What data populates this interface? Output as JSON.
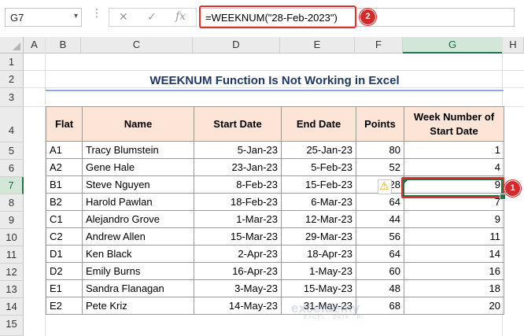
{
  "formula_bar": {
    "name_box": "G7",
    "cancel_icon": "✕",
    "confirm_icon": "✓",
    "fx_label": "fx",
    "formula": "=WEEKNUM(\"28-Feb-2023\")"
  },
  "badges": {
    "formula": "2",
    "cell": "1"
  },
  "columns": [
    "A",
    "B",
    "C",
    "D",
    "E",
    "F",
    "G",
    "H"
  ],
  "rows": [
    "1",
    "2",
    "3",
    "4",
    "5",
    "6",
    "7",
    "8",
    "9",
    "10",
    "11",
    "12",
    "13",
    "14",
    "15"
  ],
  "title": "WEEKNUM Function Is Not Working in Excel",
  "table": {
    "headers": [
      "Flat",
      "Name",
      "Start Date",
      "End Date",
      "Points",
      "Week Number of Start Date"
    ],
    "rows": [
      [
        "A1",
        "Tracy Blumstein",
        "5-Jan-23",
        "25-Jan-23",
        "80",
        "1"
      ],
      [
        "A2",
        "Gene Hale",
        "23-Jan-23",
        "5-Feb-23",
        "52",
        "4"
      ],
      [
        "B1",
        "Steve Nguyen",
        "8-Feb-23",
        "15-Feb-23",
        "28",
        "9"
      ],
      [
        "B2",
        "Harold Pawlan",
        "18-Feb-23",
        "6-Mar-23",
        "64",
        "7"
      ],
      [
        "C1",
        "Alejandro Grove",
        "1-Mar-23",
        "12-Mar-23",
        "44",
        "9"
      ],
      [
        "C2",
        "Andrew Allen",
        "15-Mar-23",
        "29-Mar-23",
        "56",
        "11"
      ],
      [
        "D1",
        "Ken Black",
        "2-Apr-23",
        "18-Apr-23",
        "64",
        "14"
      ],
      [
        "D2",
        "Emily Burns",
        "16-Apr-23",
        "1-May-23",
        "60",
        "16"
      ],
      [
        "E1",
        "Sandra Flanagan",
        "3-May-23",
        "15-May-23",
        "48",
        "18"
      ],
      [
        "E2",
        "Pete Kriz",
        "14-May-23",
        "31-May-23",
        "68",
        "20"
      ]
    ]
  },
  "watermark": {
    "name": "exceldemy",
    "tagline": "EXCEL · DATA · BI"
  },
  "colors": {
    "header_fill": "#fce4d6",
    "title_color": "#1f3864",
    "highlight": "#e03030",
    "selection": "#217346"
  }
}
